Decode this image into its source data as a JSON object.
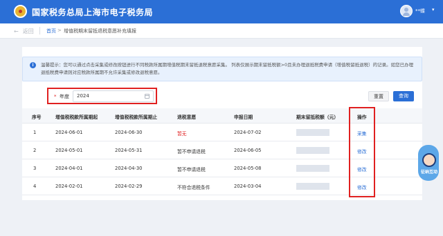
{
  "header": {
    "title": "国家税务总局上海市电子税务局",
    "username": "**蝶",
    "emblem_icon": "tax-emblem-icon",
    "brand_color": "#2b6fd6"
  },
  "breadcrumb": {
    "back_label": "返回",
    "home": "首页",
    "separator": ">",
    "current": "增值税期末留抵退税意愿补充填报"
  },
  "notice": {
    "text": "温馨提示：您可以通过点击采集或修改按钮进行不同税款所属期增值税期末留抵退税意愿采集。 列表仅展示期末留抵税额>0且未办理退抵税费申请（增值税留抵退税）的记录。如您已办理退抵税费申请则对应税款所属期不允许采集或修改退税意愿。"
  },
  "filter": {
    "required_mark": "*",
    "year_label": "年度",
    "year_value": "2024",
    "reset_label": "重置",
    "query_label": "查询"
  },
  "table": {
    "headers": [
      "序号",
      "增值税税款所属期起",
      "增值税税款所属期止",
      "退税意愿",
      "申报日期",
      "期末留抵税额（元）",
      "操作"
    ],
    "rows": [
      {
        "no": "1",
        "start": "2024-06-01",
        "end": "2024-06-30",
        "intent": "暂无",
        "date": "2024-07-02",
        "action": "采集"
      },
      {
        "no": "2",
        "start": "2024-05-01",
        "end": "2024-05-31",
        "intent": "暂不申请退税",
        "date": "2024-06-05",
        "action": "修改"
      },
      {
        "no": "3",
        "start": "2024-04-01",
        "end": "2024-04-30",
        "intent": "暂不申请退税",
        "date": "2024-05-08",
        "action": "修改"
      },
      {
        "no": "4",
        "start": "2024-02-01",
        "end": "2024-02-29",
        "intent": "不符合退税条件",
        "date": "2024-03-04",
        "action": "修改"
      }
    ]
  },
  "float_widget": {
    "label": "征纳互动"
  }
}
